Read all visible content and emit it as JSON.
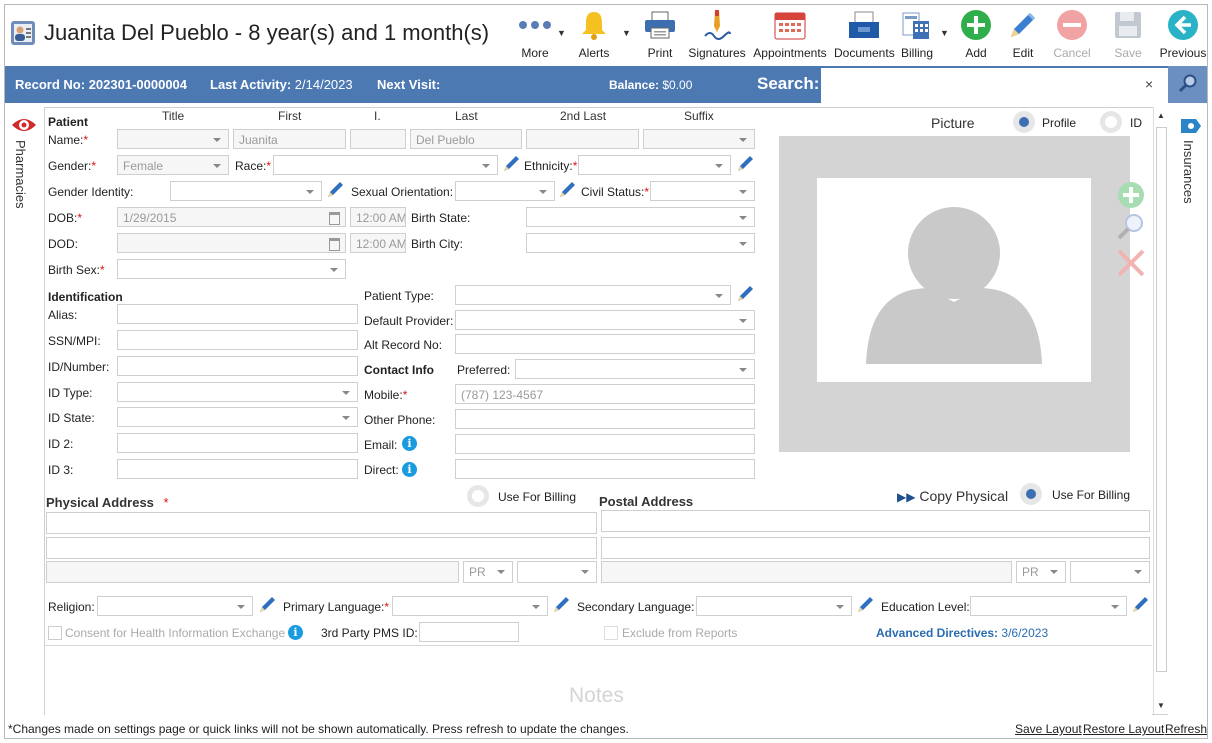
{
  "header": {
    "title": "Juanita Del Pueblo - 8 year(s) and 1 month(s)"
  },
  "toolbar": {
    "more": "More",
    "alerts": "Alerts",
    "print": "Print",
    "signatures": "Signatures",
    "appointments": "Appointments",
    "documents": "Documents",
    "billing": "Billing",
    "add": "Add",
    "edit": "Edit",
    "cancel": "Cancel",
    "save": "Save",
    "previous": "Previous"
  },
  "infobar": {
    "record_label": "Record No:",
    "record_value": "202301-0000004",
    "activity_label": "Last Activity:",
    "activity_value": "2/14/2023",
    "visit_label": "Next Visit:",
    "balance_label": "Balance:",
    "balance_value": "$0.00",
    "search_label": "Search:",
    "clear": "×"
  },
  "side_tabs": {
    "left": "Pharmacies",
    "right": "Insurances"
  },
  "patient": {
    "section": "Patient",
    "columns": {
      "title": "Title",
      "first": "First",
      "initial": "I.",
      "last": "Last",
      "second_last": "2nd Last",
      "suffix": "Suffix"
    },
    "name_label": "Name:",
    "first_name": "Juanita",
    "last_name": "Del Pueblo",
    "gender_label": "Gender:",
    "gender": "Female",
    "race_label": "Race:",
    "ethnicity_label": "Ethnicity:",
    "gender_identity_label": "Gender Identity:",
    "sexual_orientation_label": "Sexual Orientation:",
    "civil_status_label": "Civil Status:",
    "dob_label": "DOB:",
    "dob": "1/29/2015",
    "dob_time": "12:00 AM",
    "birth_state_label": "Birth State:",
    "dod_label": "DOD:",
    "dod_time": "12:00 AM",
    "birth_city_label": "Birth City:",
    "birth_sex_label": "Birth Sex:"
  },
  "identification": {
    "section": "Identification",
    "alias": "Alias:",
    "ssn": "SSN/MPI:",
    "id_number": "ID/Number:",
    "id_type": "ID Type:",
    "id_state": "ID State:",
    "id2": "ID 2:",
    "id3": "ID 3:"
  },
  "details": {
    "patient_type": "Patient Type:",
    "default_provider": "Default Provider:",
    "alt_record": "Alt Record No:",
    "contact_info": "Contact Info",
    "preferred": "Preferred:",
    "mobile_label": "Mobile:",
    "mobile": "(787) 123-4567",
    "other_phone": "Other Phone:",
    "email": "Email:",
    "direct": "Direct:"
  },
  "picture": {
    "label": "Picture",
    "profile": "Profile",
    "id": "ID"
  },
  "address": {
    "physical": "Physical Address",
    "use_billing": "Use For Billing",
    "postal": "Postal Address",
    "copy_physical": "Copy Physical",
    "state": "PR"
  },
  "bottom": {
    "religion": "Religion:",
    "primary_language": "Primary Language:",
    "secondary_language": "Secondary Language:",
    "education_level": "Education Level:",
    "consent": "Consent for Health Information Exchange",
    "third_party": "3rd Party PMS ID:",
    "exclude": "Exclude from Reports",
    "adv_label": "Advanced Directives:",
    "adv_value": "3/6/2023",
    "notes": "Notes"
  },
  "footer": {
    "message": "*Changes made on settings page or quick links will not be shown automatically. Press refresh to update the changes.",
    "save_layout": "Save Layout",
    "restore_layout": "Restore Layout",
    "refresh": "Refresh"
  },
  "colors": {
    "accent": "#4d79b2",
    "required": "#dd1111",
    "info": "#1a9be0"
  }
}
